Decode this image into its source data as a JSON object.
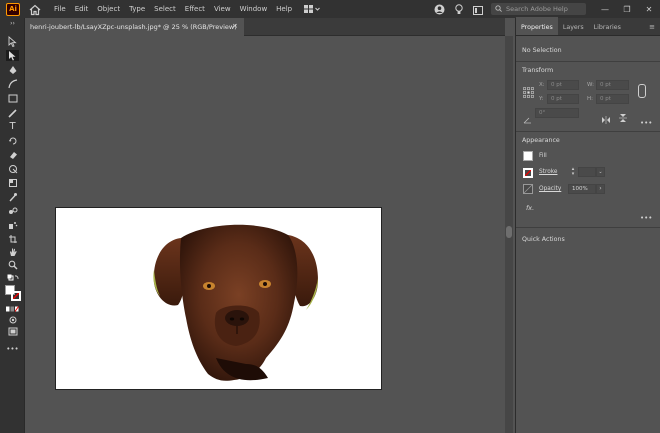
{
  "app": {
    "logo_text": "Ai",
    "accent": "#ff9a00"
  },
  "menubar": {
    "items": [
      "File",
      "Edit",
      "Object",
      "Type",
      "Select",
      "Effect",
      "View",
      "Window",
      "Help"
    ],
    "search_placeholder": "Search Adobe Help",
    "window_controls": [
      "—",
      "❐",
      "✕"
    ]
  },
  "document": {
    "tab_title": "henri-joubert-lb/LsayXZpc-unsplash.jpg* @ 25 % (RGB/Preview)",
    "close_glyph": "×"
  },
  "panel": {
    "tabs": [
      "Properties",
      "Layers",
      "Libraries"
    ],
    "active_tab": "Properties",
    "selection_text": "No Selection",
    "transform": {
      "title": "Transform",
      "x_label": "X:",
      "x_value": "0 pt",
      "y_label": "Y:",
      "y_value": "0 pt",
      "w_label": "W:",
      "w_value": "0 pt",
      "h_label": "H:",
      "h_value": "0 pt",
      "angle_value": "0°"
    },
    "appearance": {
      "title": "Appearance",
      "fill_label": "Fill",
      "stroke_label": "Stroke",
      "opacity_label": "Opacity",
      "opacity_value": "100%",
      "fx_label": "fx."
    },
    "quick_actions_title": "Quick Actions",
    "more_glyph": "•••"
  },
  "icons": [
    "home-icon",
    "workspace-switcher-icon",
    "account-icon",
    "lightbulb-icon",
    "arrange-documents-icon",
    "search-icon",
    "selection-tool-icon",
    "direct-selection-tool-icon",
    "pen-tool-icon",
    "type-tool-icon",
    "rectangle-tool-icon",
    "zoom-tool-icon"
  ]
}
